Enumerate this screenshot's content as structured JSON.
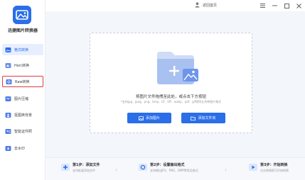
{
  "app": {
    "name": "迅捷图片转换器"
  },
  "sidebar": {
    "items": [
      {
        "label": "格式转换",
        "icon": "image-format-icon",
        "active": true
      },
      {
        "label": "Heic转换",
        "icon": "heic-icon"
      },
      {
        "label": "Raw转换",
        "icon": "raw-icon",
        "highlighted": true
      },
      {
        "label": "图片压缩",
        "icon": "compress-icon"
      },
      {
        "label": "抠图换背景",
        "icon": "cutout-icon"
      },
      {
        "label": "智能证件照",
        "icon": "id-photo-icon"
      },
      {
        "label": "去水印",
        "icon": "watermark-icon"
      }
    ]
  },
  "titlebar": {
    "home_label": "返回首页"
  },
  "dropzone": {
    "title": "将图片文件拖拽至此处，或点击下方按钮",
    "subtitle": "*支持jpg、jpeg、png、bmp、tif、tiff、webp、pdf、gif等四五余种图片格式",
    "add_image_label": "添加图片",
    "add_folder_label": "添加文件夹"
  },
  "steps": [
    {
      "title": "第1步：添加文件",
      "desc": "支持批量添加文件"
    },
    {
      "title": "第2步：设置输出格式",
      "desc": "支持输出JPG、PNG、BMP等常见格式"
    },
    {
      "title": "第3步：开始转换",
      "desc": "点击转换即可开始转换"
    }
  ],
  "colors": {
    "accent": "#2a6ee8",
    "highlight": "#e03b3b"
  }
}
